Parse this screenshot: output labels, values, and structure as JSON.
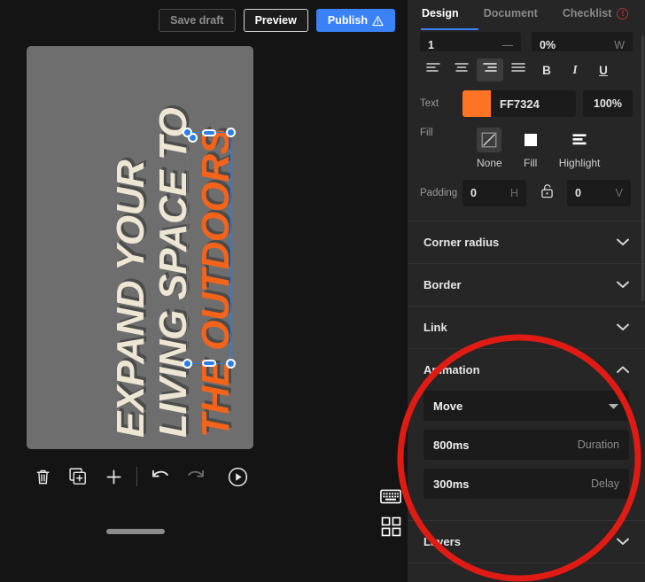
{
  "toolbar": {
    "save_draft": "Save draft",
    "preview": "Preview",
    "publish": "Publish",
    "publish_icon": "warning-triangle-icon"
  },
  "canvas": {
    "background_color": "#6E6E6E",
    "lines": [
      {
        "text": "EXPAND YOUR",
        "color": "#ECE6D3"
      },
      {
        "text": "LIVING SPACE TO",
        "color": "#ECE6D3"
      },
      {
        "text": "THE OUTDOORS",
        "color": "#F4631A"
      }
    ],
    "selected_line_index": 2,
    "selection_color": "#2B7FE8"
  },
  "tools": [
    {
      "name": "delete",
      "icon": "trash-icon",
      "enabled": true
    },
    {
      "name": "duplicate",
      "icon": "duplicate-icon",
      "enabled": true
    },
    {
      "name": "add",
      "icon": "plus-icon",
      "enabled": true
    },
    {
      "name": "undo",
      "icon": "undo-icon",
      "enabled": true
    },
    {
      "name": "redo",
      "icon": "redo-icon",
      "enabled": false
    },
    {
      "name": "play",
      "icon": "play-circle-icon",
      "enabled": true
    }
  ],
  "rail": [
    {
      "name": "keyboard",
      "icon": "keyboard-icon"
    },
    {
      "name": "grid",
      "icon": "grid-icon"
    }
  ],
  "panel": {
    "tabs": [
      {
        "label": "Design",
        "active": true
      },
      {
        "label": "Document",
        "active": false
      },
      {
        "label": "Checklist",
        "active": false,
        "badge": "!",
        "badge_color": "#B4333A"
      }
    ],
    "clipped_fields": [
      {
        "value": "1",
        "unit": ""
      },
      {
        "value": "0%",
        "unit": ""
      }
    ],
    "align_buttons": [
      {
        "name": "align-left",
        "active": false
      },
      {
        "name": "align-center",
        "active": false
      },
      {
        "name": "align-right",
        "active": true
      },
      {
        "name": "align-justify",
        "active": false
      }
    ],
    "style_buttons": [
      {
        "name": "bold",
        "glyph": "B",
        "active": false
      },
      {
        "name": "italic",
        "glyph": "I",
        "active": false
      },
      {
        "name": "underline",
        "glyph": "U",
        "active": false
      }
    ],
    "text": {
      "label": "Text",
      "color_hex": "FF7324",
      "swatch": "#FF7324",
      "opacity": "100%"
    },
    "fill": {
      "label": "Fill",
      "options": [
        {
          "label": "None",
          "icon": "no-fill-slash-icon",
          "active": true
        },
        {
          "label": "Fill",
          "icon": "solid-square-icon",
          "active": false
        },
        {
          "label": "Highlight",
          "icon": "highlight-lines-icon",
          "active": false
        }
      ]
    },
    "padding": {
      "label": "Padding",
      "horizontal": {
        "value": "0",
        "unit": "H"
      },
      "vertical": {
        "value": "0",
        "unit": "V"
      },
      "lock_icon": "unlocked-padlock-icon",
      "locked": false
    },
    "sections": [
      {
        "name": "corner-radius",
        "title": "Corner radius",
        "expanded": false,
        "chevron": "chevron-down-icon"
      },
      {
        "name": "border",
        "title": "Border",
        "expanded": false,
        "chevron": "chevron-down-icon"
      },
      {
        "name": "link",
        "title": "Link",
        "expanded": false,
        "chevron": "chevron-down-icon"
      },
      {
        "name": "animation",
        "title": "Animation",
        "expanded": true,
        "chevron": "chevron-up-icon"
      },
      {
        "name": "layers",
        "title": "Layers",
        "expanded": false,
        "chevron": "chevron-down-icon"
      }
    ],
    "animation": {
      "type": "Move",
      "type_icon": "caret-down-icon",
      "duration_value": "800ms",
      "duration_label": "Duration",
      "delay_value": "300ms",
      "delay_label": "Delay"
    }
  },
  "annotation": {
    "shape": "ellipse",
    "color": "#E01B14",
    "target": "animation-section"
  }
}
